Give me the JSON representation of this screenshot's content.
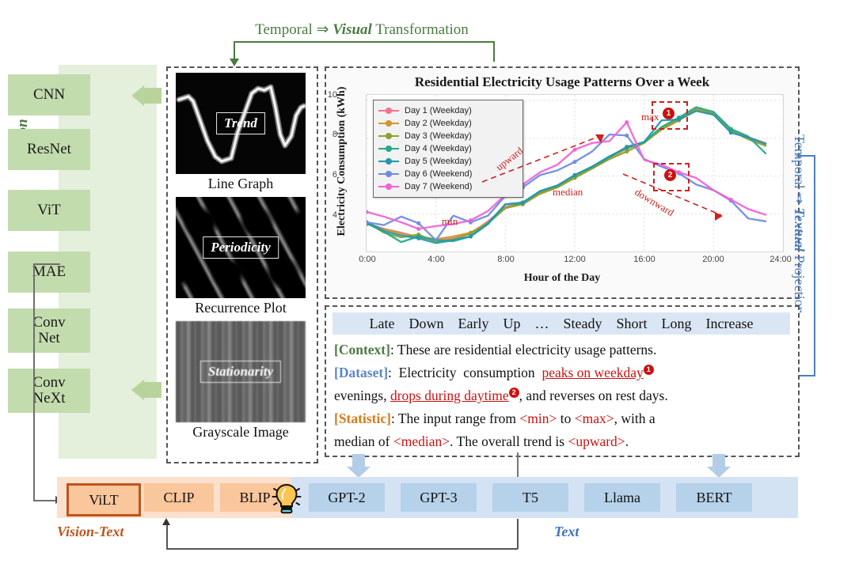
{
  "top_caption": {
    "prefix": "Temporal ⇒ ",
    "emphasis": "Visual",
    "suffix": " Transformation"
  },
  "right_caption": {
    "prefix": "Temporal ⇒ ",
    "emphasis": "Textual",
    "suffix": " Projection"
  },
  "vision": {
    "axis_label": "Vision",
    "models": [
      "CNN",
      "ResNet",
      "ViT",
      "MAE",
      "Conv Net",
      "Conv NeXt"
    ]
  },
  "modalities": [
    {
      "tag": "Trend",
      "caption": "Line Graph"
    },
    {
      "tag": "Periodicity",
      "caption": "Recurrence Plot"
    },
    {
      "tag": "Stationarity",
      "caption": "Grayscale Image"
    }
  ],
  "chart_data": {
    "type": "line",
    "title": "Residential Electricity Usage Patterns Over a Week",
    "xlabel": "Hour of the Day",
    "ylabel": "Electricity Consumption (kWh)",
    "xlim": [
      0,
      24
    ],
    "ylim": [
      2.0,
      10.3
    ],
    "xticks": [
      "0:00",
      "4:00",
      "8:00",
      "12:00",
      "16:00",
      "20:00",
      "24:00"
    ],
    "xtick_values": [
      0,
      4,
      8,
      12,
      16,
      20,
      24
    ],
    "yticks": [
      "4",
      "6",
      "8",
      "10"
    ],
    "ytick_values": [
      4,
      6,
      8,
      10
    ],
    "grid": true,
    "legend_position": "upper-left",
    "x": [
      0,
      1,
      2,
      3,
      4,
      5,
      6,
      7,
      8,
      9,
      10,
      11,
      12,
      13,
      14,
      15,
      16,
      17,
      18,
      19,
      20,
      21,
      22,
      23
    ],
    "series": [
      {
        "name": "Day 1 (Weekday)",
        "color": "#f2728f",
        "values": [
          3.5,
          3.2,
          3.0,
          2.75,
          2.6,
          2.7,
          2.95,
          3.6,
          4.35,
          4.6,
          5.1,
          5.45,
          6.0,
          6.45,
          7.0,
          7.55,
          7.8,
          8.5,
          9.0,
          9.5,
          9.35,
          8.45,
          8.05,
          7.75
        ]
      },
      {
        "name": "Day 2 (Weekday)",
        "color": "#d1972f",
        "values": [
          3.45,
          3.2,
          2.95,
          2.8,
          2.65,
          2.8,
          3.0,
          3.55,
          4.3,
          4.5,
          5.05,
          5.4,
          5.95,
          6.4,
          6.95,
          7.45,
          7.8,
          8.45,
          8.95,
          9.5,
          9.25,
          8.4,
          8.0,
          7.7
        ]
      },
      {
        "name": "Day 3 (Weekday)",
        "color": "#8aa32e",
        "values": [
          3.55,
          3.0,
          2.75,
          2.9,
          2.5,
          2.65,
          2.95,
          3.5,
          4.3,
          4.55,
          5.1,
          5.4,
          5.9,
          6.4,
          6.9,
          7.3,
          7.75,
          8.5,
          9.0,
          9.6,
          9.3,
          8.4,
          7.95,
          7.6
        ]
      },
      {
        "name": "Day 4 (Weekday)",
        "color": "#25a98b",
        "values": [
          3.5,
          3.05,
          2.5,
          2.8,
          2.6,
          2.55,
          2.8,
          3.5,
          4.5,
          4.55,
          5.2,
          5.5,
          6.05,
          6.5,
          7.0,
          7.55,
          7.8,
          8.6,
          9.1,
          9.65,
          9.4,
          8.5,
          8.1,
          7.2
        ]
      },
      {
        "name": "Day 5 (Weekday)",
        "color": "#2497ae",
        "values": [
          3.55,
          3.1,
          2.85,
          2.7,
          2.45,
          2.6,
          2.8,
          3.45,
          4.5,
          4.6,
          5.2,
          5.5,
          6.05,
          6.5,
          7.05,
          7.5,
          7.8,
          8.95,
          9.0,
          9.45,
          9.25,
          8.3,
          8.05,
          7.7
        ]
      },
      {
        "name": "Day 6 (Weekend)",
        "color": "#6f8ce0",
        "values": [
          3.55,
          3.4,
          3.85,
          3.5,
          2.6,
          3.9,
          3.55,
          3.9,
          4.95,
          5.4,
          6.05,
          6.3,
          6.75,
          7.3,
          8.2,
          8.15,
          6.9,
          6.5,
          6.15,
          5.55,
          5.25,
          4.7,
          3.75,
          3.6
        ]
      },
      {
        "name": "Day 7 (Weekend)",
        "color": "#ef63d7",
        "values": [
          4.1,
          3.85,
          3.55,
          3.2,
          3.35,
          3.45,
          3.65,
          4.15,
          5.0,
          5.55,
          6.2,
          6.6,
          7.4,
          7.75,
          7.85,
          8.85,
          6.85,
          6.6,
          6.2,
          5.9,
          5.25,
          4.75,
          4.25,
          3.95
        ]
      }
    ],
    "annotations": [
      {
        "text": "min",
        "type": "label"
      },
      {
        "text": "max",
        "type": "label"
      },
      {
        "text": "median",
        "type": "label"
      },
      {
        "text": "upward",
        "type": "trend-arrow"
      },
      {
        "text": "downward",
        "type": "trend-arrow"
      },
      {
        "text": "1",
        "type": "highlight-badge"
      },
      {
        "text": "2",
        "type": "highlight-badge"
      }
    ],
    "annotation_color": "#cc2222"
  },
  "text_panel": {
    "tokens": [
      "Late",
      "Down",
      "Early",
      "Up",
      "…",
      "Steady",
      "Short",
      "Long",
      "Increase"
    ],
    "lines": [
      {
        "tag": "[Context]",
        "tag_color": "#4a7c3f",
        "text": ": These are residential electricity usage patterns."
      },
      {
        "tag": "[Dataset]",
        "tag_color": "#5b85c4",
        "text": ": Electricity consumption peaks on weekday"
      },
      {
        "tag": "",
        "tag_color": "",
        "text": "evenings, drops during daytime, and reverses on rest days."
      },
      {
        "tag": "[Statistic]",
        "tag_color": "#d77a1b",
        "text": ": The input range from <min> to <max>, with a"
      },
      {
        "tag": "",
        "tag_color": "",
        "text": "median of <median>. The overall trend is <upward>."
      }
    ],
    "highlight_1": "peaks on weekday",
    "highlight_2": "drops during daytime",
    "placeholders": [
      "<min>",
      "<max>",
      "<median>",
      "<upward>"
    ]
  },
  "bottom": {
    "vision_text_label": "Vision-Text",
    "text_label": "Text",
    "vision_text_models": [
      "ViLT",
      "CLIP",
      "BLIP"
    ],
    "text_models": [
      "GPT-2",
      "GPT-3",
      "T5",
      "Llama",
      "BERT"
    ],
    "selected_model": "ViLT",
    "bulb_icon": "lightbulb-icon"
  },
  "colors": {
    "vision_panel": "#e4efdc",
    "vision_box": "#c3dcae",
    "vision_accent": "#4a7c3f",
    "text_accent": "#4a7fc1",
    "vision_text_bg": "#fbe0cd",
    "vision_text_box": "#fac69b",
    "text_bg": "#d3e3f3",
    "text_box": "#b6d2ea",
    "highlight_red": "#cc1111",
    "vilt_border": "#c0541a"
  }
}
